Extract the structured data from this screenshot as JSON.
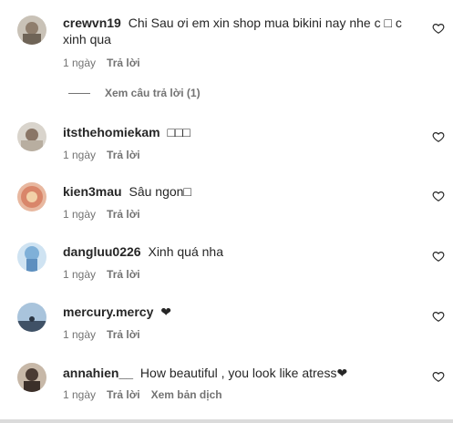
{
  "comments": [
    {
      "user": "crewvn19",
      "text": "Chi Sau ơi em xin shop mua bikini nay nhe c □ c xinh qua",
      "time": "1 ngày",
      "reply": "Trả lời"
    },
    {
      "user": "itsthehomiekam",
      "text": "□□□",
      "time": "1 ngày",
      "reply": "Trả lời"
    },
    {
      "user": "kien3mau",
      "text": "Sâu ngon□",
      "time": "1 ngày",
      "reply": "Trả lời"
    },
    {
      "user": "dangluu0226",
      "text": "Xinh quá nha",
      "time": "1 ngày",
      "reply": "Trả lời"
    },
    {
      "user": "mercury.mercy",
      "text": "❤",
      "time": "1 ngày",
      "reply": "Trả lời"
    },
    {
      "user": "annahien__",
      "text": "How beautiful , you look like atress❤",
      "time": "1 ngày",
      "reply": "Trả lời",
      "translate": "Xem bản dịch"
    }
  ],
  "view_replies": "Xem câu trả lời (1)",
  "icons": {
    "like": "heart-outline-icon"
  }
}
